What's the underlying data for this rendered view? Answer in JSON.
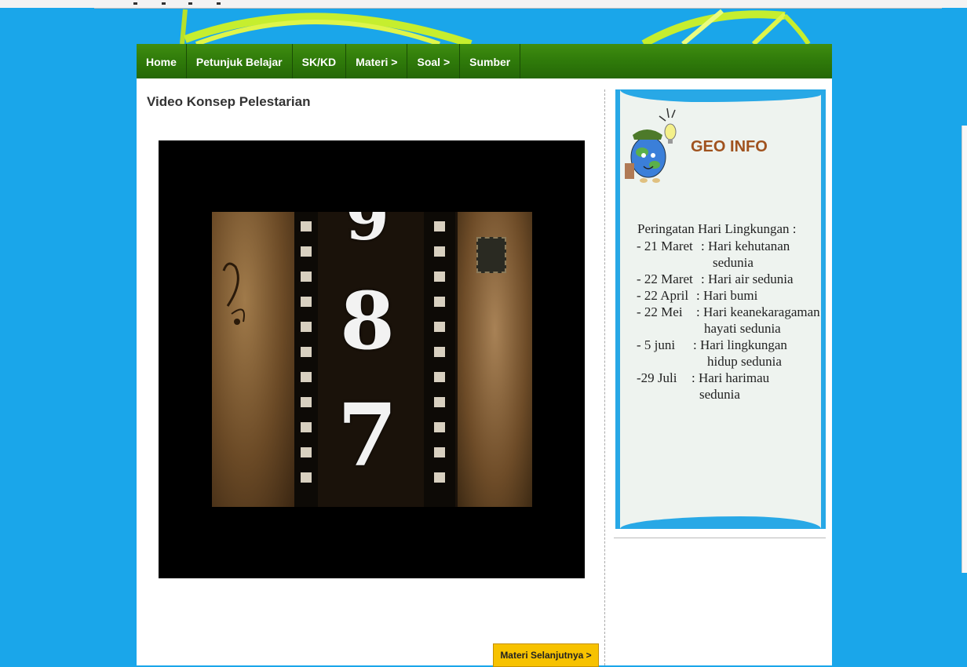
{
  "nav": {
    "items": [
      {
        "label": "Home"
      },
      {
        "label": "Petunjuk Belajar"
      },
      {
        "label": "SK/KD"
      },
      {
        "label": "Materi >"
      },
      {
        "label": "Soal >"
      },
      {
        "label": "Sumber"
      }
    ]
  },
  "main": {
    "title": "Video Konsep Pelestarian",
    "video_digits": [
      "8",
      "7"
    ],
    "next_button": "Materi Selanjutnya >"
  },
  "sidebar": {
    "card_title": "GEO INFO",
    "heading": "Peringatan Hari Lingkungan :",
    "events": [
      {
        "date": "- 21 Maret",
        "event": ": Hari kehutanan",
        "cont": "sedunia"
      },
      {
        "date": "- 22 Maret",
        "event": ": Hari air sedunia",
        "cont": ""
      },
      {
        "date": "- 22 April",
        "event": ": Hari bumi",
        "cont": ""
      },
      {
        "date": "- 22 Mei",
        "event": ": Hari keanekaragaman",
        "cont": "hayati sedunia"
      },
      {
        "date": "- 5 juni",
        "event": ": Hari lingkungan",
        "cont": "hidup sedunia"
      },
      {
        "date": "-29 Juli",
        "event": ": Hari harimau",
        "cont": "sedunia"
      }
    ]
  },
  "colors": {
    "background": "#1aa6ea",
    "nav_green": "#2f7a0a",
    "button_yellow": "#f7c200",
    "geo_title": "#a0521e"
  }
}
